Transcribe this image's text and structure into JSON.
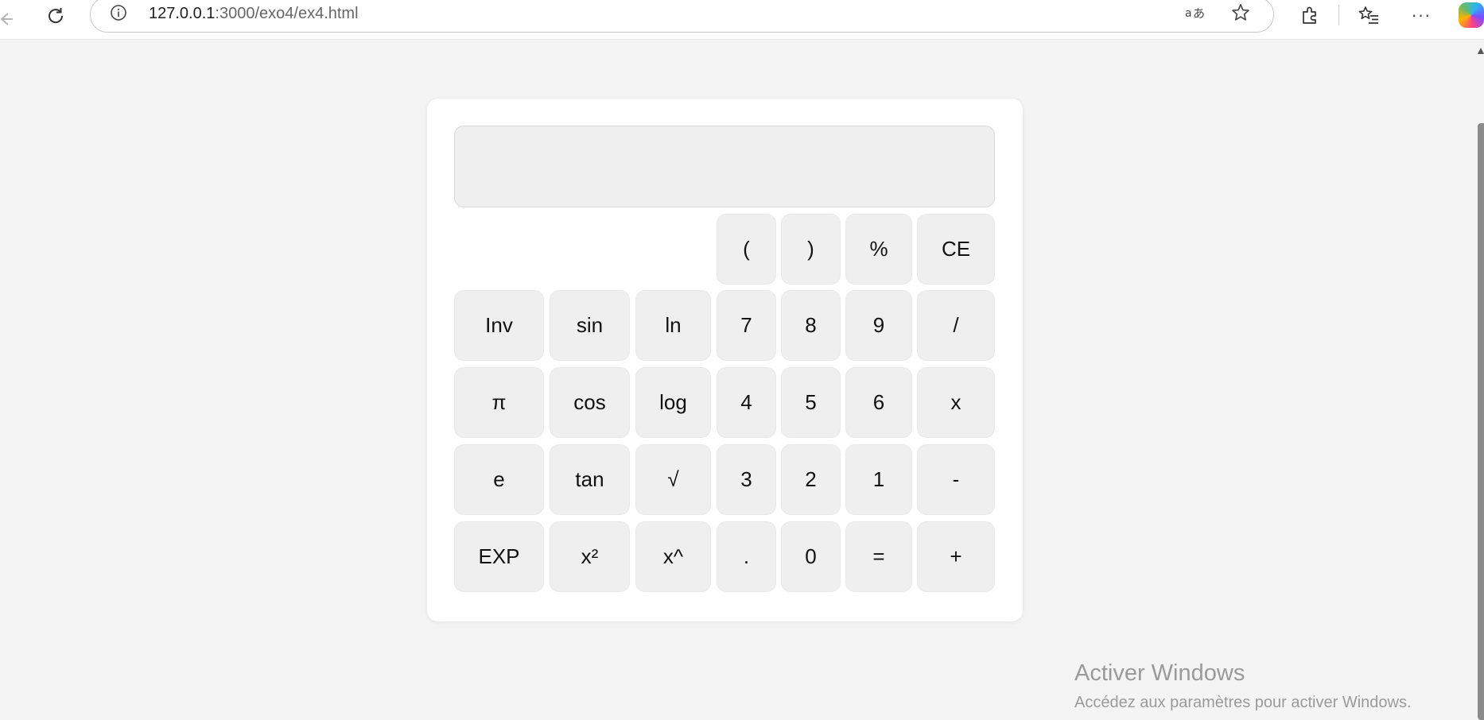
{
  "browser": {
    "url_host": "127.0.0.1",
    "url_path": ":3000/exo4/ex4.html",
    "more_glyph": "···"
  },
  "calculator": {
    "display_value": "",
    "rows": [
      [
        "(",
        ")",
        "%",
        "CE"
      ],
      [
        "Inv",
        "sin",
        "ln",
        "7",
        "8",
        "9",
        "/"
      ],
      [
        "π",
        "cos",
        "log",
        "4",
        "5",
        "6",
        "x"
      ],
      [
        "e",
        "tan",
        "√",
        "3",
        "2",
        "1",
        "-"
      ],
      [
        "EXP",
        "x²",
        "x^",
        ".",
        "0",
        "=",
        "+"
      ]
    ]
  },
  "watermark": {
    "title": "Activer Windows",
    "subtitle": "Accédez aux paramètres pour activer Windows."
  }
}
